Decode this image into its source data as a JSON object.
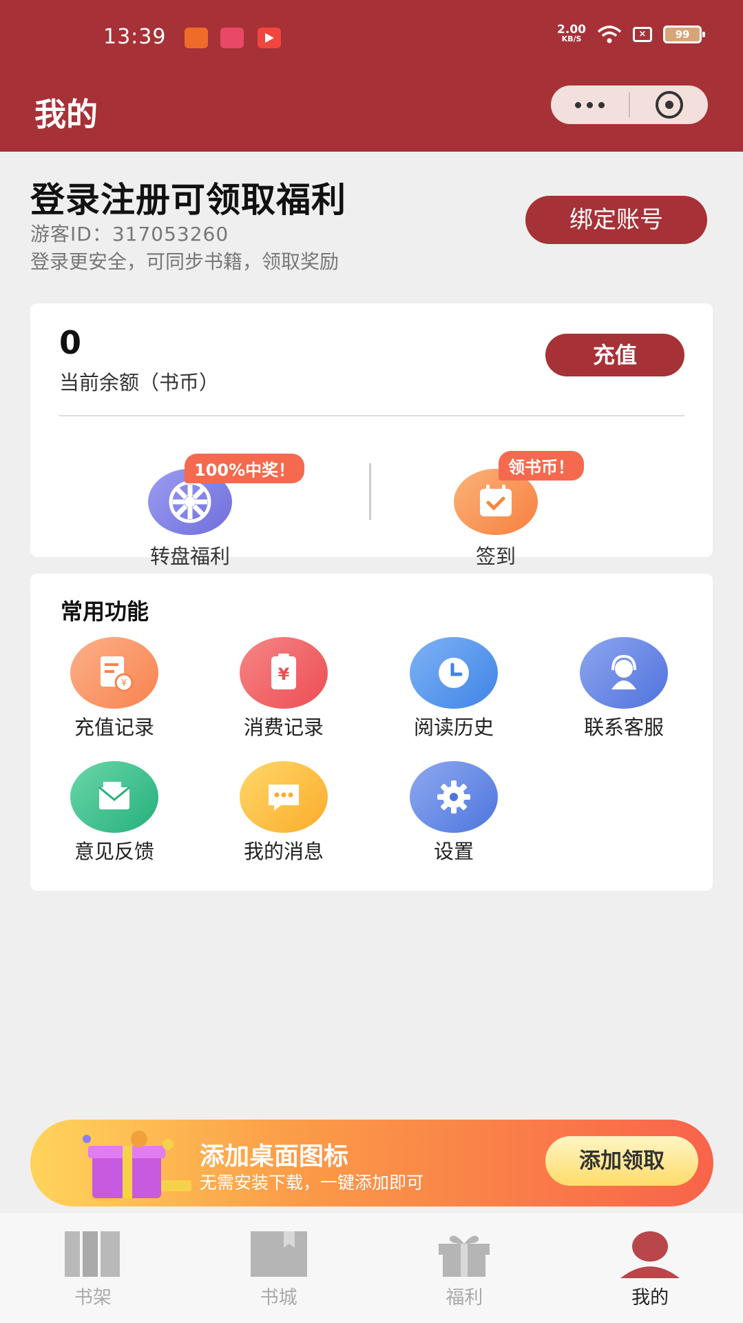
{
  "status_bar": {
    "time": "13:39",
    "net_speed_value": "2.00",
    "net_speed_unit": "KB/S",
    "battery": "99"
  },
  "header": {
    "title": "我的"
  },
  "account": {
    "login_title": "登录注册可领取福利",
    "guest_id": "游客ID：317053260",
    "login_desc": "登录更安全，可同步书籍，领取奖励",
    "bind_button": "绑定账号"
  },
  "balance": {
    "value": "0",
    "label": "当前余额（书币）",
    "recharge_button": "充值"
  },
  "welfare": [
    {
      "label": "转盘福利",
      "badge": "100%中奖！",
      "icon": "wheel-icon",
      "color": "#7d7ee6"
    },
    {
      "label": "签到",
      "badge": "领书币！",
      "icon": "calendar-check-icon",
      "color": "#f99052"
    }
  ],
  "functions": {
    "title": "常用功能",
    "items": [
      {
        "label": "充值记录",
        "icon": "recharge-record-icon",
        "color": "#f98e5f"
      },
      {
        "label": "消费记录",
        "icon": "consumption-record-icon",
        "color": "#f05a5a"
      },
      {
        "label": "阅读历史",
        "icon": "clock-icon",
        "color": "#4e92ec"
      },
      {
        "label": "联系客服",
        "icon": "customer-service-icon",
        "color": "#5b7fe0"
      },
      {
        "label": "意见反馈",
        "icon": "feedback-mail-icon",
        "color": "#3bbe8c"
      },
      {
        "label": "我的消息",
        "icon": "message-icon",
        "color": "#fbbd3c"
      },
      {
        "label": "设置",
        "icon": "settings-gear-icon",
        "color": "#5a82e3"
      }
    ]
  },
  "promo": {
    "title": "添加桌面图标",
    "subtitle": "无需安装下载，一键添加即可",
    "button": "添加领取"
  },
  "tabs": [
    {
      "label": "书架",
      "icon": "bookshelf-icon",
      "active": false
    },
    {
      "label": "书城",
      "icon": "bookstore-icon",
      "active": false
    },
    {
      "label": "福利",
      "icon": "gift-icon",
      "active": false
    },
    {
      "label": "我的",
      "icon": "profile-icon",
      "active": true
    }
  ]
}
